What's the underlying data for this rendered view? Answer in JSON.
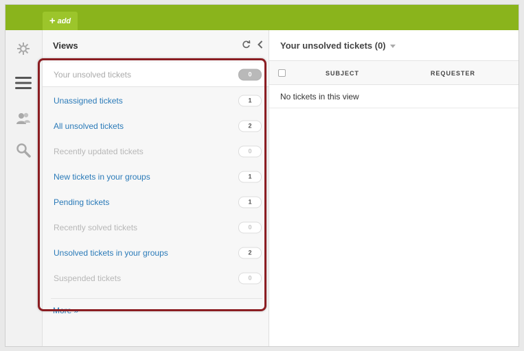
{
  "topbar": {
    "add_label": "add",
    "add_icon": "plus-icon",
    "accent_color": "#8ab41c"
  },
  "rail": {
    "items": [
      {
        "icon": "zendesk-logo-icon"
      },
      {
        "icon": "views-menu-icon"
      },
      {
        "icon": "users-icon"
      },
      {
        "icon": "search-icon"
      }
    ]
  },
  "views": {
    "title": "Views",
    "refresh_icon": "refresh-icon",
    "collapse_icon": "chevron-left-icon",
    "items": [
      {
        "label": "Your unsolved tickets",
        "count": "0",
        "state": "active"
      },
      {
        "label": "Unassigned tickets",
        "count": "1",
        "state": "link"
      },
      {
        "label": "All unsolved tickets",
        "count": "2",
        "state": "link"
      },
      {
        "label": "Recently updated tickets",
        "count": "0",
        "state": "muted"
      },
      {
        "label": "New tickets in your groups",
        "count": "1",
        "state": "link"
      },
      {
        "label": "Pending tickets",
        "count": "1",
        "state": "link"
      },
      {
        "label": "Recently solved tickets",
        "count": "0",
        "state": "muted"
      },
      {
        "label": "Unsolved tickets in your groups",
        "count": "2",
        "state": "link"
      },
      {
        "label": "Suspended tickets",
        "count": "0",
        "state": "muted"
      }
    ],
    "more_label": "More »",
    "highlight_color": "#8b1d22"
  },
  "main": {
    "title": "Your unsolved tickets (0)",
    "columns": [
      "SUBJECT",
      "REQUESTER"
    ],
    "empty_message": "No tickets in this view"
  }
}
